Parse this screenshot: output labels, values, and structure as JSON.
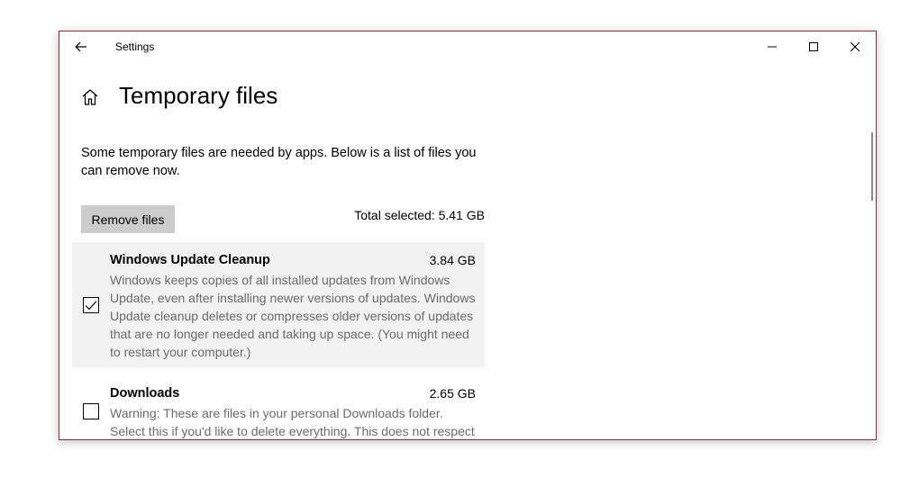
{
  "window": {
    "title": "Settings",
    "back_icon": "back-arrow-icon",
    "controls": {
      "minimize_icon": "minimize-icon",
      "maximize_icon": "maximize-icon",
      "close_icon": "close-icon"
    }
  },
  "page": {
    "home_icon": "home-icon",
    "title": "Temporary files",
    "intro": "Some temporary files are needed by apps. Below is a list of files you can remove now.",
    "remove_button_label": "Remove files",
    "total_selected": "Total selected: 5.41 GB"
  },
  "items": [
    {
      "name": "Windows Update Cleanup",
      "size": "3.84 GB",
      "checked": true,
      "description": "Windows keeps copies of all installed updates from Windows Update, even after installing newer versions of updates. Windows Update cleanup deletes or compresses older versions of updates that are no longer needed and taking up space. (You might need to restart your computer.)"
    },
    {
      "name": "Downloads",
      "size": "2.65 GB",
      "checked": false,
      "description": "Warning: These are files in your personal Downloads folder. Select this if you'd like to delete everything. This does not respect your Storage Sense configuration."
    }
  ],
  "colors": {
    "window_border": "#8b2e2e",
    "selected_row_bg": "#f2f2f2",
    "button_bg": "#cccccc",
    "description_text": "#6b6b6b"
  }
}
